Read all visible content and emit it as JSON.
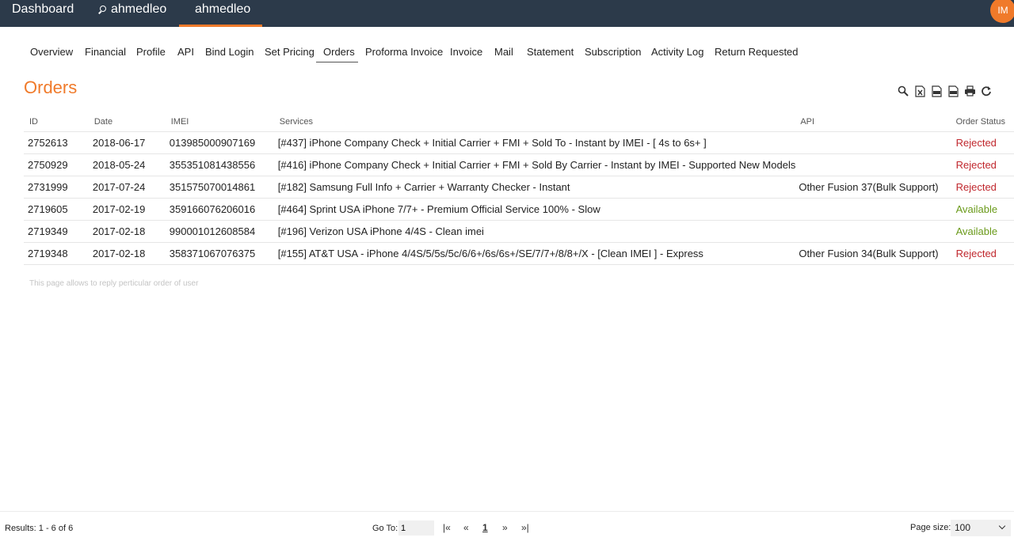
{
  "topbar": {
    "dashboard": "Dashboard",
    "search_user": "ahmedleo",
    "current_user": "ahmedleo",
    "avatar_initials": "IM"
  },
  "tabs": [
    "Overview",
    "Financial",
    "Profile",
    "API",
    "Bind Login",
    "Set Pricing",
    "Orders",
    "Proforma Invoice",
    "Invoice",
    "Mail",
    "Statement",
    "Subscription",
    "Activity Log",
    "Return Requested"
  ],
  "page": {
    "title": "Orders"
  },
  "toolbar": [
    "search-icon",
    "excel-export-icon",
    "pdf-export-icon",
    "pdf-export-icon",
    "print-icon",
    "refresh-icon"
  ],
  "table": {
    "headers": [
      "ID",
      "Date",
      "IMEI",
      "Services",
      "API",
      "Order Status"
    ],
    "rows": [
      [
        "2752613",
        "2018-06-17",
        "013985000907169",
        "[#437] iPhone Company Check + Initial Carrier + FMI + Sold To - Instant by IMEI - [ 4s to 6s+ ]",
        "",
        "Rejected"
      ],
      [
        "2750929",
        "2018-05-24",
        "355351081438556",
        "[#416] iPhone Company Check + Initial Carrier + FMI + Sold By Carrier - Instant by IMEI - Supported New Models",
        "",
        "Rejected"
      ],
      [
        "2731999",
        "2017-07-24",
        "351575070014861",
        "[#182] Samsung Full Info + Carrier + Warranty Checker - Instant",
        "Other Fusion 37(Bulk Support)",
        "Rejected"
      ],
      [
        "2719605",
        "2017-02-19",
        "359166076206016",
        "[#464] Sprint USA iPhone 7/7+ - Premium Official Service 100% - Slow",
        "",
        "Available"
      ],
      [
        "2719349",
        "2017-02-18",
        "990001012608584",
        "[#196] Verizon USA iPhone 4/4S - Clean imei",
        "",
        "Available"
      ],
      [
        "2719348",
        "2017-02-18",
        "358371067076375",
        "[#155] AT&T USA - iPhone 4/4S/5/5s/5c/6/6+/6s/6s+/SE/7/7+/8/8+/X - [Clean IMEI ] - Express",
        "Other Fusion 34(Bulk Support)",
        "Rejected"
      ]
    ]
  },
  "hint": "This page allows to reply perticular order of user",
  "footer": {
    "results": "Results: 1 - 6 of 6",
    "goto_label": "Go To:",
    "goto_value": "1",
    "first": "|«",
    "prev": "«",
    "current_page": "1",
    "next": "»",
    "last": "»|",
    "page_size_label": "Page size:",
    "page_size": "100"
  },
  "colors": {
    "accent": "#f07a2a",
    "topbar": "#2c3a4a",
    "rejected": "#c0272d",
    "available": "#6a9a1a"
  }
}
